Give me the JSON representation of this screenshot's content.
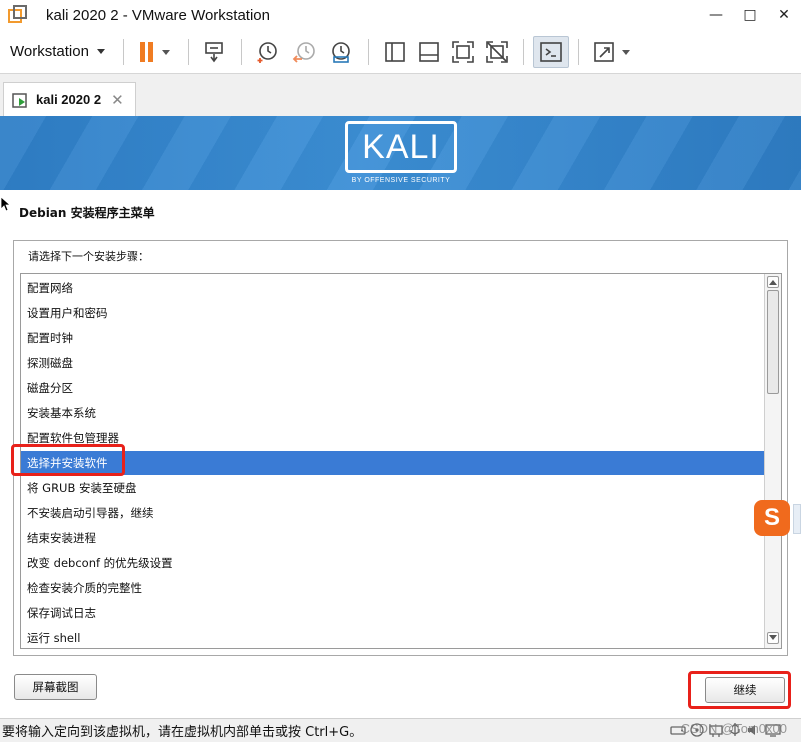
{
  "window": {
    "title": "kali 2020 2 - VMware Workstation",
    "controls": [
      "—",
      "□",
      "✕"
    ]
  },
  "toolbar": {
    "workstation_menu": "Workstation",
    "icons": [
      "pause-icon",
      "send-keys-icon",
      "snapshot-icon",
      "revert-snapshot-icon",
      "snapshot-manager-icon",
      "library-view-icon",
      "thumbnail-view-icon",
      "full-screen-icon",
      "unity-icon",
      "console-view-icon",
      "stretch-icon"
    ]
  },
  "tab": {
    "label": "kali 2020 2",
    "close": "✕"
  },
  "banner": {
    "logo_text": "KALI",
    "logo_sub": "BY OFFENSIVE SECURITY"
  },
  "installer": {
    "title": "Debian 安装程序主菜单",
    "prompt": "请选择下一个安装步骤：",
    "items": [
      "配置网络",
      "设置用户和密码",
      "配置时钟",
      "探测磁盘",
      "磁盘分区",
      "安装基本系统",
      "配置软件包管理器",
      "选择并安装软件",
      "将 GRUB 安装至硬盘",
      "不安装启动引导器，继续",
      "结束安装进程",
      "改变 debconf 的优先级设置",
      "检查安装介质的完整性",
      "保存调试日志",
      "运行 shell"
    ],
    "selected_index": 7,
    "screenshot_button": "屏幕截图",
    "continue_button": "继续"
  },
  "ime": {
    "label": "S"
  },
  "status": {
    "text": "要将输入定向到该虚拟机，请在虚拟机内部单击或按 Ctrl+G。",
    "watermark": "CSDN @Tom0x00"
  },
  "colors": {
    "selection": "#3a7bd5",
    "highlight_box": "#e8211a",
    "banner": "#3c8fd6",
    "pause_icon": "#f07c22"
  }
}
